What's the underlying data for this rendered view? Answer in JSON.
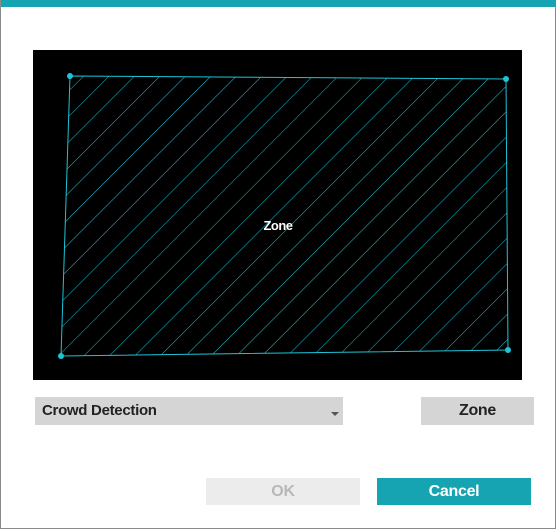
{
  "colors": {
    "accent": "#17a4b2",
    "zone_outline": "#1ec4d6",
    "viewport_bg": "#000000",
    "control_bg": "#d5d5d5"
  },
  "zone": {
    "label": "Zone"
  },
  "detection_select": {
    "selected": "Crowd Detection"
  },
  "buttons": {
    "zone": "Zone",
    "ok": "OK",
    "cancel": "Cancel"
  },
  "icons": {
    "dropdown": "chevron-down-icon",
    "vertex": "zone-vertex-handle"
  }
}
